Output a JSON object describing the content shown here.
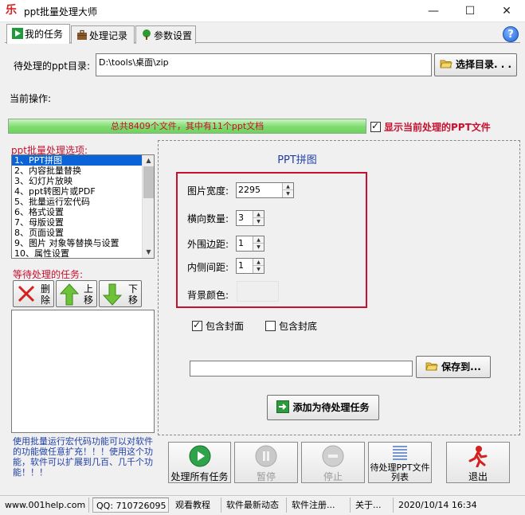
{
  "window": {
    "title": "ppt批量处理大师",
    "app_icon_glyph": "乐",
    "minimize": "—",
    "maximize": "☐",
    "close": "✕"
  },
  "tabs": [
    {
      "label": "我的任务",
      "icon": "play-icon",
      "active": true
    },
    {
      "label": "处理记录",
      "icon": "briefcase-icon",
      "active": false
    },
    {
      "label": "参数设置",
      "icon": "tree-icon",
      "active": false
    }
  ],
  "help": {
    "glyph": "?"
  },
  "dir": {
    "label": "待处理的ppt目录:",
    "value": "D:\\tools\\桌面\\zip",
    "browse_label": "选择目录. . ."
  },
  "current_op": {
    "label": "当前操作:"
  },
  "progress": {
    "text": "总共8409个文件，其中有11个ppt文档",
    "fill_percent": 100
  },
  "show_current": {
    "label": "显示当前处理的PPT文件",
    "checked": true
  },
  "options": {
    "label": "ppt批量处理选项:",
    "items": [
      "1、PPT拼图",
      "2、内容批量替换",
      "3、幻灯片放映",
      "4、ppt转图片或PDF",
      "5、批量运行宏代码",
      "6、格式设置",
      "7、母版设置",
      "8、页面设置",
      "9、图片 对象等替换与设置",
      "10、属性设置"
    ],
    "selected_index": 0
  },
  "queue": {
    "label": "等待处理的任务:",
    "delete_label": "删\n除",
    "up_label": "上\n移",
    "down_label": "下\n移"
  },
  "panel": {
    "title": "PPT拼图",
    "width_label": "图片宽度:",
    "width_value": "2295",
    "count_label": "横向数量:",
    "count_value": "3",
    "outer_label": "外围边距:",
    "outer_value": "1",
    "inner_label": "内侧间距:",
    "inner_value": "1",
    "bg_label": "背景颜色:",
    "bg_color": "#efefef",
    "include_cover": {
      "label": "包含封面",
      "checked": true
    },
    "include_back": {
      "label": "包含封底",
      "checked": false
    },
    "save_path": "",
    "save_label": "保存到...",
    "add_task_label": "添加为待处理任务"
  },
  "hint": {
    "text": "使用批量运行宏代码功能可以对软件的功能做任意扩充！！！使用这个功能，软件可以扩展到几百、几千个功能！！！"
  },
  "actions": {
    "process_all": "处理所有任务",
    "pause": "暂停",
    "stop": "停止",
    "pending_list": "待处理PPT文件列表",
    "exit": "退出"
  },
  "status": {
    "website": "www.001help.com",
    "qq": "QQ:  710726095",
    "tutorial": "观看教程",
    "news": "软件最新动态",
    "register": "软件注册...",
    "about": "关于...",
    "datetime": "2020/10/14   16:34"
  },
  "colors": {
    "accent_red": "#c8102e",
    "accent_blue": "#1f3fa8",
    "selection": "#0a64d8",
    "progress_green": "#7edc6e"
  }
}
